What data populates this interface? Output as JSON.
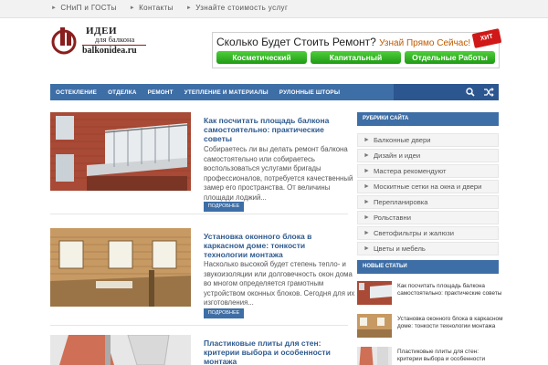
{
  "topbar": {
    "links": [
      "СНиП и ГОСТы",
      "Контакты",
      "Узнайте стоимость услуг"
    ]
  },
  "logo": {
    "top": "ИДЕИ",
    "middle": "для балкона",
    "domain": "balkonidea.ru"
  },
  "banner": {
    "headline": "Сколько Будет Стоить Ремонт?",
    "subline": "Узнай Прямо Сейчас!",
    "badge": "ХИТ",
    "buttons": [
      "Косметический",
      "Капитальный",
      "Отдельные Работы"
    ],
    "button_color": "#2fb522"
  },
  "nav": {
    "items": [
      "ОСТЕКЛЕНИЕ",
      "ОТДЕЛКА",
      "РЕМОНТ",
      "УТЕПЛЕНИЕ И МАТЕРИАЛЫ",
      "РУЛОННЫЕ ШТОРЫ"
    ],
    "icons": [
      "search-icon",
      "shuffle-icon"
    ],
    "color": "#3e6ea6"
  },
  "posts": [
    {
      "title": "Как посчитать площадь балкона самостоятельно: практические советы",
      "excerpt": "Собираетесь ли вы делать ремонт балкона самостоятельно или собираетесь воспользоваться услугами бригады профессионалов, потребуется качественный замер его пространства. От величины площади лоджий...",
      "more": "ПОДРОБНЕЕ"
    },
    {
      "title": "Установка оконного блока в каркасном доме: тонкости технологии монтажа",
      "excerpt": "Насколько высокой будет степень тепло- и звукоизоляции или долговечность окон дома во многом определяется грамотным устройством оконных блоков. Сегодня для их изготовления...",
      "more": "ПОДРОБНЕЕ"
    },
    {
      "title": "Пластиковые плиты для стен: критерии выбора и особенности монтажа",
      "excerpt": "",
      "more": ""
    }
  ],
  "sidebar": {
    "categories_title": "РУБРИКИ САЙТА",
    "categories": [
      "Балконные двери",
      "Дизайн и идеи",
      "Мастера рекомендуют",
      "Москитные сетки на окна и двери",
      "Перепланировка",
      "Рольставни",
      "Светофильтры и жалюзи",
      "Цветы и мебель"
    ],
    "new_title": "НОВЫЕ СТАТЬИ",
    "new_posts": [
      "Как посчитать площадь балкона самостоятельно: практические советы",
      "Установка оконного блока в каркасном доме: тонкости технологии монтажа",
      "Пластиковые плиты для стен: критерии выбора и особенности"
    ]
  }
}
